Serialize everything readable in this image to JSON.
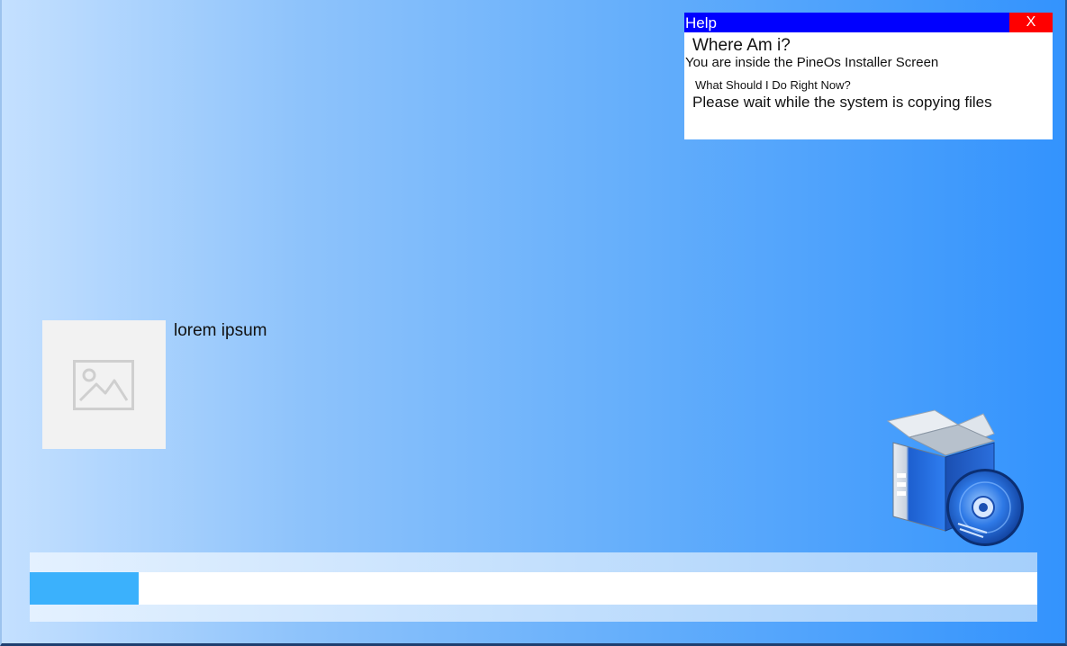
{
  "help_panel": {
    "title": "Help",
    "close_label": "X",
    "heading1": "Where Am i?",
    "text1": "You are inside the PineOs Installer Screen",
    "heading2": "What Should I Do Right Now?",
    "text2": "Please wait while the system is copying files"
  },
  "slide": {
    "image_icon": "image-placeholder-icon",
    "caption": "lorem ipsum"
  },
  "installer_icon": "software-box-with-disc-icon",
  "progress": {
    "fraction": 0.108,
    "fill_color": "#3bb1fc"
  },
  "colors": {
    "titlebar": "#0000ff",
    "close_button": "#ff0000",
    "background_start": "#c4e0ff",
    "background_end": "#3393fd"
  }
}
